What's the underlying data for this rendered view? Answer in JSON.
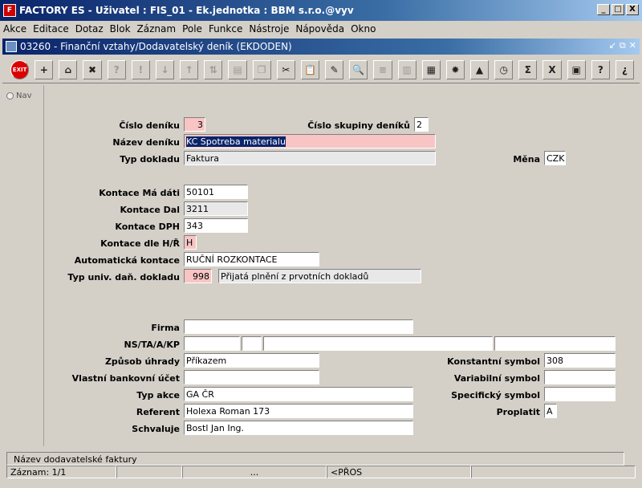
{
  "window": {
    "title": "FACTORY ES - Uživatel : FIS_01 - Ek.jednotka : BBM s.r.o.@vyv",
    "min": "_",
    "max": "□",
    "close": "X"
  },
  "menu": [
    "Akce",
    "Editace",
    "Dotaz",
    "Blok",
    "Záznam",
    "Pole",
    "Funkce",
    "Nástroje",
    "Nápověda",
    "Okno"
  ],
  "form_title": "03260 - Finanční vztahy/Dodavatelský deník (EKDODEN)",
  "toolbar": {
    "exit": "EXIT"
  },
  "nav": {
    "label": "Nav"
  },
  "fields": {
    "cislo_deniku": {
      "label": "Číslo deníku",
      "value": "3"
    },
    "cislo_skupiny": {
      "label": "Číslo skupiny deníků",
      "value": "2"
    },
    "nazev_deniku": {
      "label": "Název deníku",
      "value": "KC  Spotreba materialu"
    },
    "typ_dokladu": {
      "label": "Typ dokladu",
      "value": "Faktura"
    },
    "mena": {
      "label": "Měna",
      "value": "CZK"
    },
    "kontace_ma_dati": {
      "label": "Kontace Má dáti",
      "value": "50101"
    },
    "kontace_dal": {
      "label": "Kontace Dal",
      "value": "3211"
    },
    "kontace_dph": {
      "label": "Kontace DPH",
      "value": "343"
    },
    "kontace_dle": {
      "label": "Kontace dle H/Ř",
      "value": "H"
    },
    "automaticka_kontace": {
      "label": "Automatická kontace",
      "value": "RUČNÍ ROZKONTACE"
    },
    "typ_univ": {
      "label": "Typ univ. daň. dokladu",
      "value": "998",
      "desc": "Přijatá plnění z prvotních dokladů"
    },
    "firma": {
      "label": "Firma",
      "value": ""
    },
    "ns_ta": {
      "label": "NS/TA/A/KP",
      "value": ""
    },
    "zpusob_uhrady": {
      "label": "Způsob úhrady",
      "value": "Příkazem"
    },
    "konstantni_symbol": {
      "label": "Konstantní symbol",
      "value": "308"
    },
    "vlastni_ucet": {
      "label": "Vlastní bankovní účet",
      "value": ""
    },
    "variabilni_symbol": {
      "label": "Variabilní symbol",
      "value": ""
    },
    "typ_akce": {
      "label": "Typ akce",
      "value": "GA ČR"
    },
    "specificky_symbol": {
      "label": "Specifický symbol",
      "value": ""
    },
    "referent": {
      "label": "Referent",
      "value": "Holexa Roman 173"
    },
    "proplatit": {
      "label": "Proplatit",
      "value": "A"
    },
    "schvaluje": {
      "label": "Schvaluje",
      "value": "Bostl Jan Ing."
    }
  },
  "hint": "Název dodavatelské faktury",
  "status": {
    "record": "Záznam: 1/1",
    "mid": "...",
    "mode": "<PŘOS"
  }
}
